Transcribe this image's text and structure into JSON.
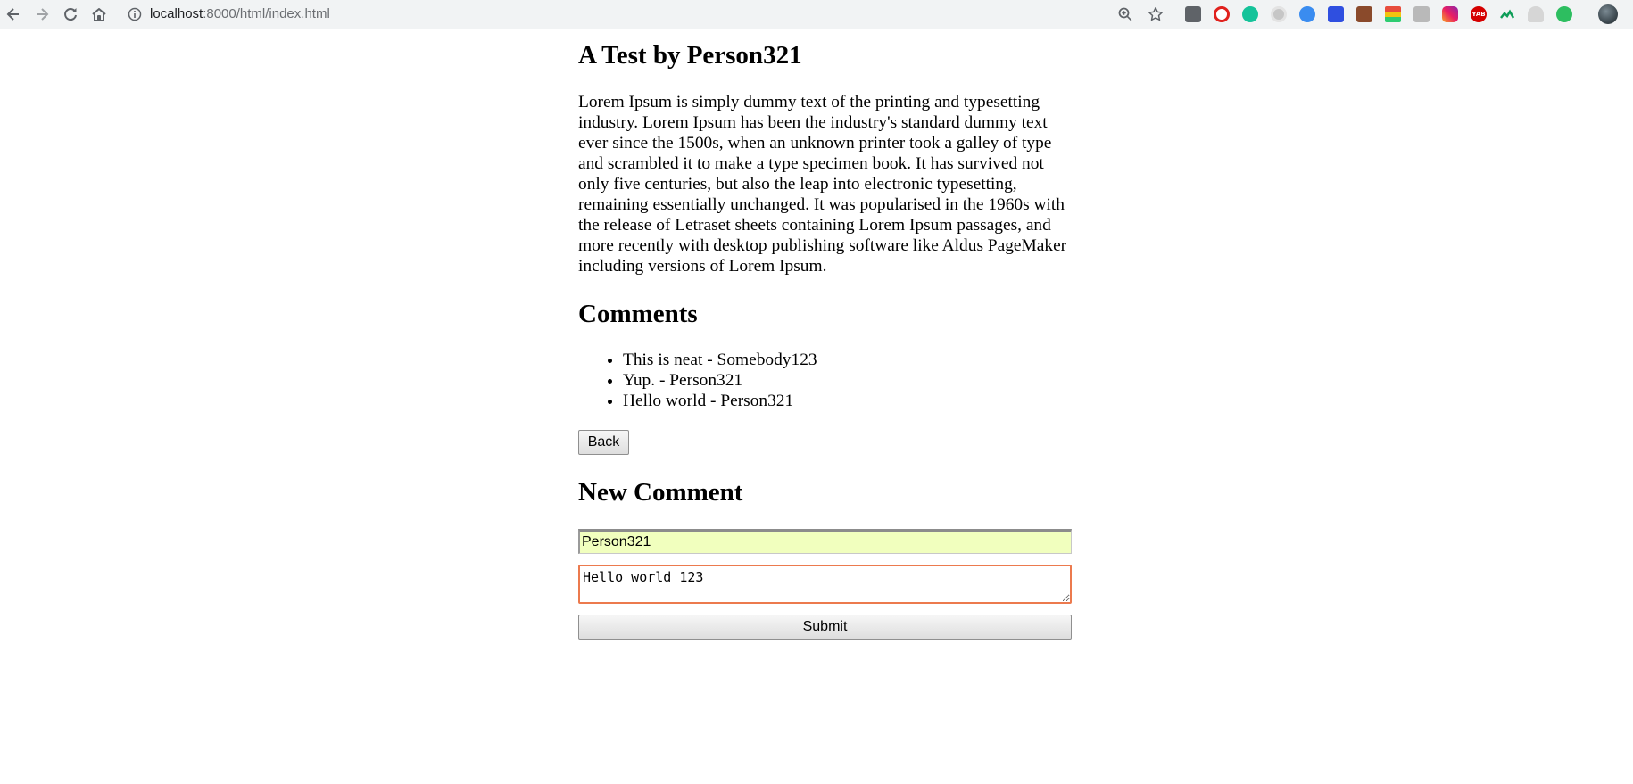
{
  "browser": {
    "url_host": "localhost",
    "url_path": ":8000/html/index.html",
    "icons": {
      "back": "arrow-left-icon",
      "forward": "arrow-right-icon",
      "reload": "reload-icon",
      "home": "home-icon",
      "site_info": "info-icon",
      "zoom": "zoom-icon",
      "bookmark": "star-icon"
    },
    "extension_badges": {
      "yab": "YAB"
    }
  },
  "page": {
    "title": "A Test by Person321",
    "body": "Lorem Ipsum is simply dummy text of the printing and typesetting industry. Lorem Ipsum has been the industry's standard dummy text ever since the 1500s, when an unknown printer took a galley of type and scrambled it to make a type specimen book. It has survived not only five centuries, but also the leap into electronic typesetting, remaining essentially unchanged. It was popularised in the 1960s with the release of Letraset sheets containing Lorem Ipsum passages, and more recently with desktop publishing software like Aldus PageMaker including versions of Lorem Ipsum.",
    "comments_heading": "Comments",
    "comments": [
      "This is neat - Somebody123",
      "Yup. - Person321",
      "Hello world - Person321"
    ],
    "back_label": "Back",
    "new_comment_heading": "New Comment",
    "name_value": "Person321",
    "comment_value": "Hello world 123",
    "submit_label": "Submit"
  },
  "colors": {
    "name_input_bg": "#f1ffbe",
    "textarea_focus_border": "#ec7a4e"
  }
}
